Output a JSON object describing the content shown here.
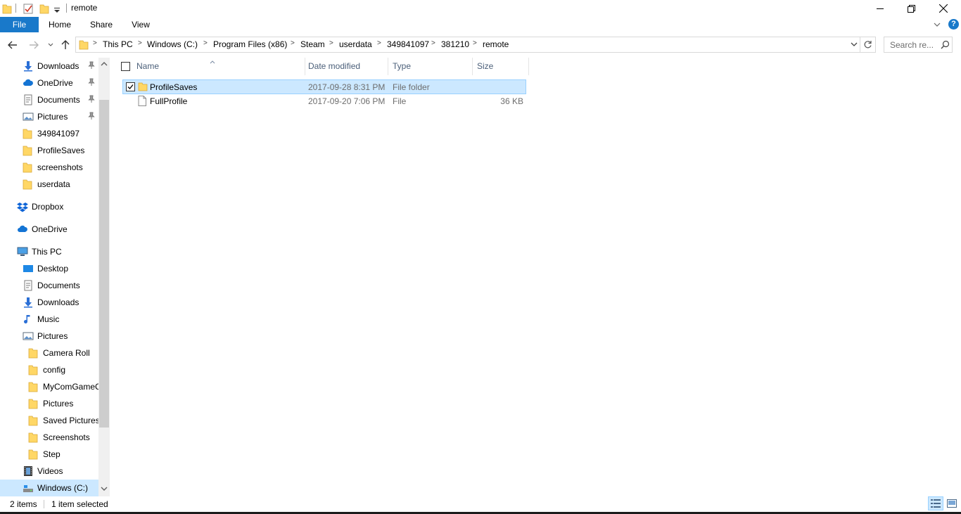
{
  "window": {
    "title": "remote"
  },
  "ribbon": {
    "tabs": [
      "File",
      "Home",
      "Share",
      "View"
    ]
  },
  "address": {
    "crumbs": [
      "This PC",
      "Windows (C:)",
      "Program Files (x86)",
      "Steam",
      "userdata",
      "349841097",
      "381210",
      "remote"
    ]
  },
  "search": {
    "placeholder": "Search re..."
  },
  "nav": {
    "items": [
      {
        "label": "Downloads",
        "icon": "download-icon",
        "pinned": true
      },
      {
        "label": "OneDrive",
        "icon": "onedrive-icon",
        "pinned": true
      },
      {
        "label": "Documents",
        "icon": "documents-icon",
        "pinned": true
      },
      {
        "label": "Pictures",
        "icon": "pictures-icon",
        "pinned": true
      },
      {
        "label": "349841097",
        "icon": "folder-icon",
        "pinned": false
      },
      {
        "label": "ProfileSaves",
        "icon": "folder-icon",
        "pinned": false
      },
      {
        "label": "screenshots",
        "icon": "folder-icon",
        "pinned": false
      },
      {
        "label": "userdata",
        "icon": "folder-icon",
        "pinned": false
      },
      {
        "label": "Dropbox",
        "icon": "dropbox-icon",
        "pinned": false
      },
      {
        "label": "OneDrive",
        "icon": "onedrive-icon",
        "pinned": false
      },
      {
        "label": "This PC",
        "icon": "computer-icon",
        "pinned": false
      },
      {
        "label": "Desktop",
        "icon": "desktop-icon",
        "pinned": false
      },
      {
        "label": "Documents",
        "icon": "documents-icon",
        "pinned": false
      },
      {
        "label": "Downloads",
        "icon": "download-icon",
        "pinned": false
      },
      {
        "label": "Music",
        "icon": "music-icon",
        "pinned": false
      },
      {
        "label": "Pictures",
        "icon": "pictures-icon",
        "pinned": false
      },
      {
        "label": "Camera Roll",
        "icon": "folder-icon",
        "pinned": false
      },
      {
        "label": "config",
        "icon": "folder-icon",
        "pinned": false
      },
      {
        "label": "MyComGameC",
        "icon": "folder-icon",
        "pinned": false
      },
      {
        "label": "Pictures",
        "icon": "folder-icon",
        "pinned": false
      },
      {
        "label": "Saved Pictures",
        "icon": "folder-icon",
        "pinned": false
      },
      {
        "label": "Screenshots",
        "icon": "folder-icon",
        "pinned": false
      },
      {
        "label": "Step",
        "icon": "folder-icon",
        "pinned": false
      },
      {
        "label": "Videos",
        "icon": "videos-icon",
        "pinned": false
      },
      {
        "label": "Windows (C:)",
        "icon": "drive-icon",
        "pinned": false
      }
    ]
  },
  "columns": [
    "Name",
    "Date modified",
    "Type",
    "Size"
  ],
  "files": [
    {
      "name": "ProfileSaves",
      "date": "2017-09-28 8:31 PM",
      "type": "File folder",
      "size": "",
      "icon": "folder-icon",
      "selected": true
    },
    {
      "name": "FullProfile",
      "date": "2017-09-20 7:06 PM",
      "type": "File",
      "size": "36 KB",
      "icon": "file-icon",
      "selected": false
    }
  ],
  "status": {
    "count": "2 items",
    "selected": "1 item selected"
  },
  "colors": {
    "accent": "#1979ca",
    "selection": "#cce8ff",
    "selection_border": "#99d1ff",
    "folder": "#ffd766"
  }
}
